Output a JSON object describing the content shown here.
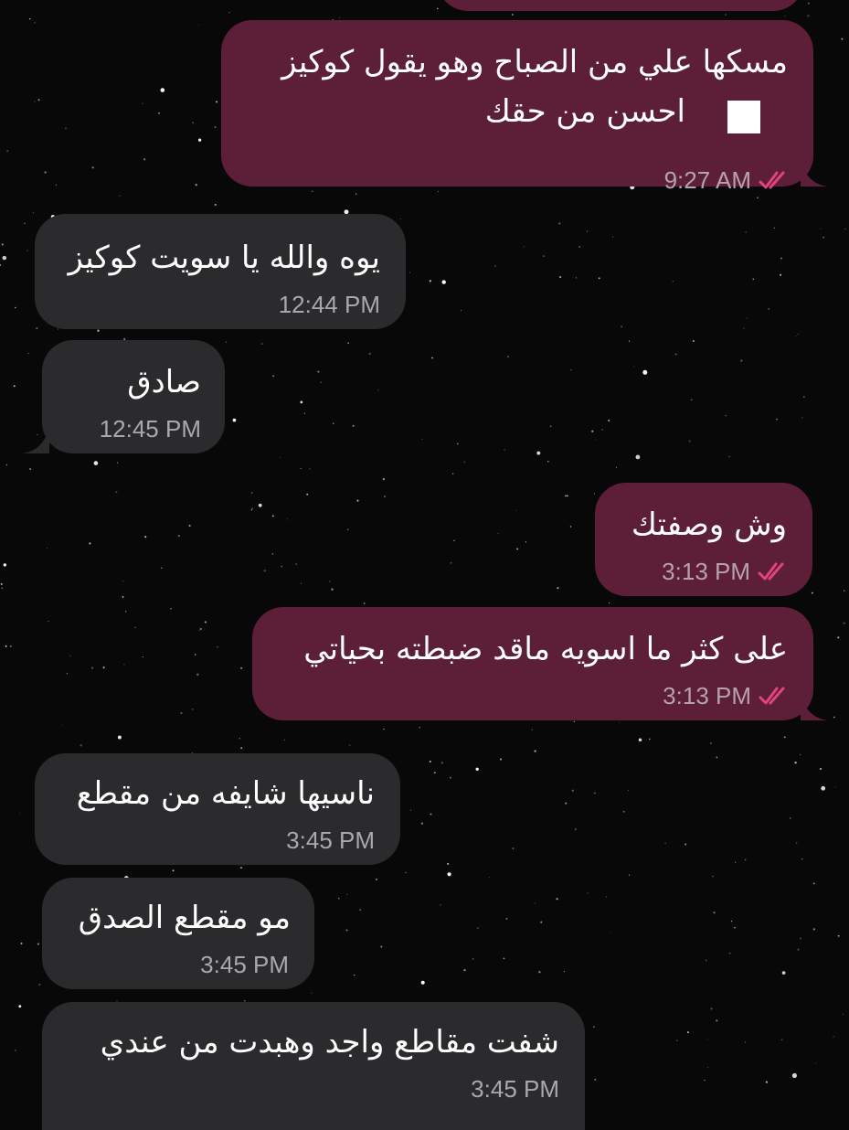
{
  "colors": {
    "outgoing_bubble": "#5d1e37",
    "incoming_bubble": "#2b2b2d",
    "read_ticks": "#e0457b",
    "background": "#080808"
  },
  "messages": [
    {
      "direction": "outgoing",
      "lines": [
        "مسكها علي من الصباح وهو يقول كوكيز",
        "احسن من حقك"
      ],
      "time": "9:27 AM",
      "status": "read-ticks-icon"
    },
    {
      "direction": "incoming",
      "lines": [
        "يوه والله يا سويت كوكيز"
      ],
      "time": "12:44 PM"
    },
    {
      "direction": "incoming",
      "lines": [
        "صادق"
      ],
      "time": "12:45 PM"
    },
    {
      "direction": "outgoing",
      "lines": [
        "وش وصفتك"
      ],
      "time": "3:13 PM",
      "status": "read-ticks-icon"
    },
    {
      "direction": "outgoing",
      "lines": [
        "على كثر ما اسويه ماقد ضبطته بحياتي"
      ],
      "time": "3:13 PM",
      "status": "read-ticks-icon"
    },
    {
      "direction": "incoming",
      "lines": [
        "ناسيها شايفه من مقطع"
      ],
      "time": "3:45 PM"
    },
    {
      "direction": "incoming",
      "lines": [
        "مو مقطع الصدق"
      ],
      "time": "3:45 PM"
    },
    {
      "direction": "incoming",
      "lines": [
        "شفت مقاطع واجد وهبدت من عندي"
      ],
      "time": "3:45 PM"
    }
  ]
}
